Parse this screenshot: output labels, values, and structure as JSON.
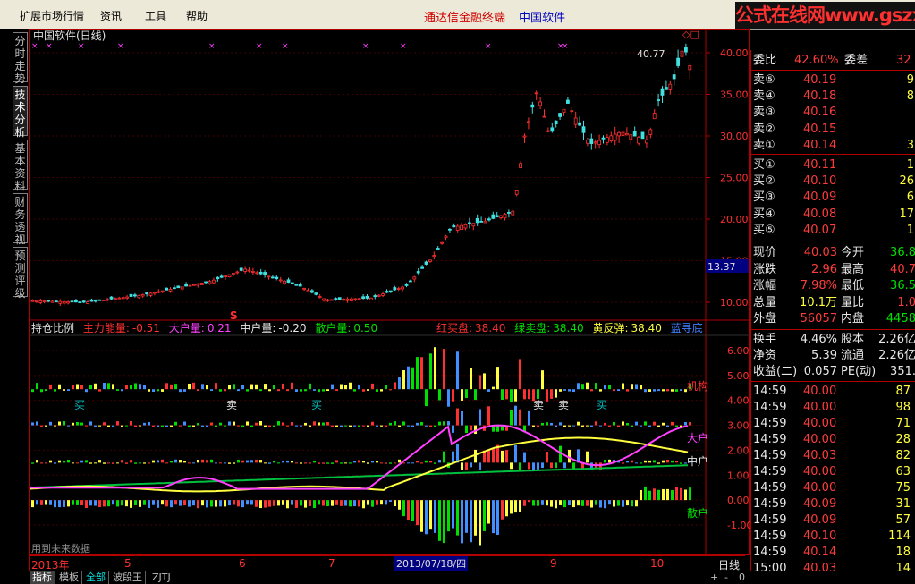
{
  "menu": {
    "items": [
      "扩展市场行情",
      "资讯",
      "工具",
      "帮助"
    ],
    "title_red": "通达信金融终端",
    "title_blue": "中国软件"
  },
  "watermark": "公式在线网www.gszx.com.cn",
  "left_tabs": [
    "分时走势",
    "技术分析",
    "基本资料",
    "财务透视",
    "预测评级"
  ],
  "main_chart": {
    "title": "中国软件(日线)",
    "price_ticks": [
      "40.00",
      "35.00",
      "30.00",
      "25.00",
      "20.00",
      "15.00",
      "10.00"
    ],
    "peak_label": "40.77",
    "current_price_tag": "13.37",
    "signal_marker": "S"
  },
  "indicator": {
    "name": "持仓比例",
    "params": [
      {
        "label": "主力能量:",
        "value": "-0.51",
        "color": "#ff3030"
      },
      {
        "label": "大户量:",
        "value": "0.21",
        "color": "#ff40ff"
      },
      {
        "label": "中户量:",
        "value": "-0.20",
        "color": "#e8e8e8"
      },
      {
        "label": "散户量:",
        "value": "0.50",
        "color": "#00e000"
      }
    ],
    "params2": [
      {
        "label": "红买盘:",
        "value": "38.40",
        "color": "#ff3030"
      },
      {
        "label": "绿卖盘:",
        "value": "38.40",
        "color": "#00e000"
      },
      {
        "label": "黄反弹:",
        "value": "38.40",
        "color": "#ffff40"
      },
      {
        "label": "蓝寻底",
        "value": "",
        "color": "#4080ff"
      }
    ],
    "ticks": [
      "6.00",
      "5.00",
      "4.00",
      "3.00",
      "2.00",
      "1.00",
      "0.00",
      "-1.00"
    ],
    "line_labels": [
      "机构",
      "大户",
      "中户",
      "散户"
    ],
    "signals": [
      "买",
      "卖",
      "买",
      "卖",
      "卖",
      "买"
    ],
    "footnote": "用到未来数据"
  },
  "date_axis": {
    "labels": [
      "2013年",
      "5",
      "6",
      "7",
      "2013/07/18/四",
      "9",
      "10"
    ],
    "period": "日线"
  },
  "quote": {
    "weibi_label": "委比",
    "weibi_value": "42.60%",
    "weicha_label": "委差",
    "weicha_value": "32",
    "asks": [
      {
        "label": "卖⑤",
        "price": "40.19",
        "vol": "9"
      },
      {
        "label": "卖④",
        "price": "40.18",
        "vol": "8"
      },
      {
        "label": "卖③",
        "price": "40.16",
        "vol": ""
      },
      {
        "label": "卖②",
        "price": "40.15",
        "vol": ""
      },
      {
        "label": "卖①",
        "price": "40.14",
        "vol": "3"
      }
    ],
    "bids": [
      {
        "label": "买①",
        "price": "40.11",
        "vol": "1"
      },
      {
        "label": "买②",
        "price": "40.10",
        "vol": "26"
      },
      {
        "label": "买③",
        "price": "40.09",
        "vol": "6"
      },
      {
        "label": "买④",
        "price": "40.08",
        "vol": "17"
      },
      {
        "label": "买⑤",
        "price": "40.07",
        "vol": "1"
      }
    ],
    "stats": [
      {
        "l1": "现价",
        "v1": "40.03",
        "c1": "red",
        "l2": "今开",
        "v2": "36.8",
        "c2": "green"
      },
      {
        "l1": "涨跌",
        "v1": "2.96",
        "c1": "red",
        "l2": "最高",
        "v2": "40.7",
        "c2": "red"
      },
      {
        "l1": "涨幅",
        "v1": "7.98%",
        "c1": "red",
        "l2": "最低",
        "v2": "36.5",
        "c2": "green"
      },
      {
        "l1": "总量",
        "v1": "10.1万",
        "c1": "yellow",
        "l2": "量比",
        "v2": "1.0",
        "c2": "red"
      },
      {
        "l1": "外盘",
        "v1": "56057",
        "c1": "red",
        "l2": "内盘",
        "v2": "4458",
        "c2": "green"
      }
    ],
    "finance": [
      {
        "l1": "换手",
        "v1": "4.46%",
        "l2": "股本",
        "v2": "2.26亿"
      },
      {
        "l1": "净资",
        "v1": "5.39",
        "l2": "流通",
        "v2": "2.26亿"
      },
      {
        "l1": "收益(二)",
        "v1": "0.057",
        "l2": "PE(动)",
        "v2": "351."
      }
    ],
    "ticks": [
      {
        "time": "14:59",
        "price": "40.00",
        "vol": "87",
        "c": "red"
      },
      {
        "time": "14:59",
        "price": "40.00",
        "vol": "98",
        "c": "red"
      },
      {
        "time": "14:59",
        "price": "40.00",
        "vol": "71",
        "c": "red"
      },
      {
        "time": "14:59",
        "price": "40.00",
        "vol": "28",
        "c": "red"
      },
      {
        "time": "14:59",
        "price": "40.03",
        "vol": "82",
        "c": "red"
      },
      {
        "time": "14:59",
        "price": "40.00",
        "vol": "63",
        "c": "red"
      },
      {
        "time": "14:59",
        "price": "40.00",
        "vol": "75",
        "c": "red"
      },
      {
        "time": "14:59",
        "price": "40.09",
        "vol": "31",
        "c": "red"
      },
      {
        "time": "14:59",
        "price": "40.09",
        "vol": "57",
        "c": "red"
      },
      {
        "time": "14:59",
        "price": "40.10",
        "vol": "114",
        "c": "red"
      },
      {
        "time": "14:59",
        "price": "40.14",
        "vol": "18",
        "c": "red"
      },
      {
        "time": "15:00",
        "price": "40.03",
        "vol": "14",
        "c": "red"
      }
    ]
  },
  "bottom_tabs": [
    "指标",
    "模板",
    "全部",
    "波段王",
    "ZJTJ"
  ]
}
